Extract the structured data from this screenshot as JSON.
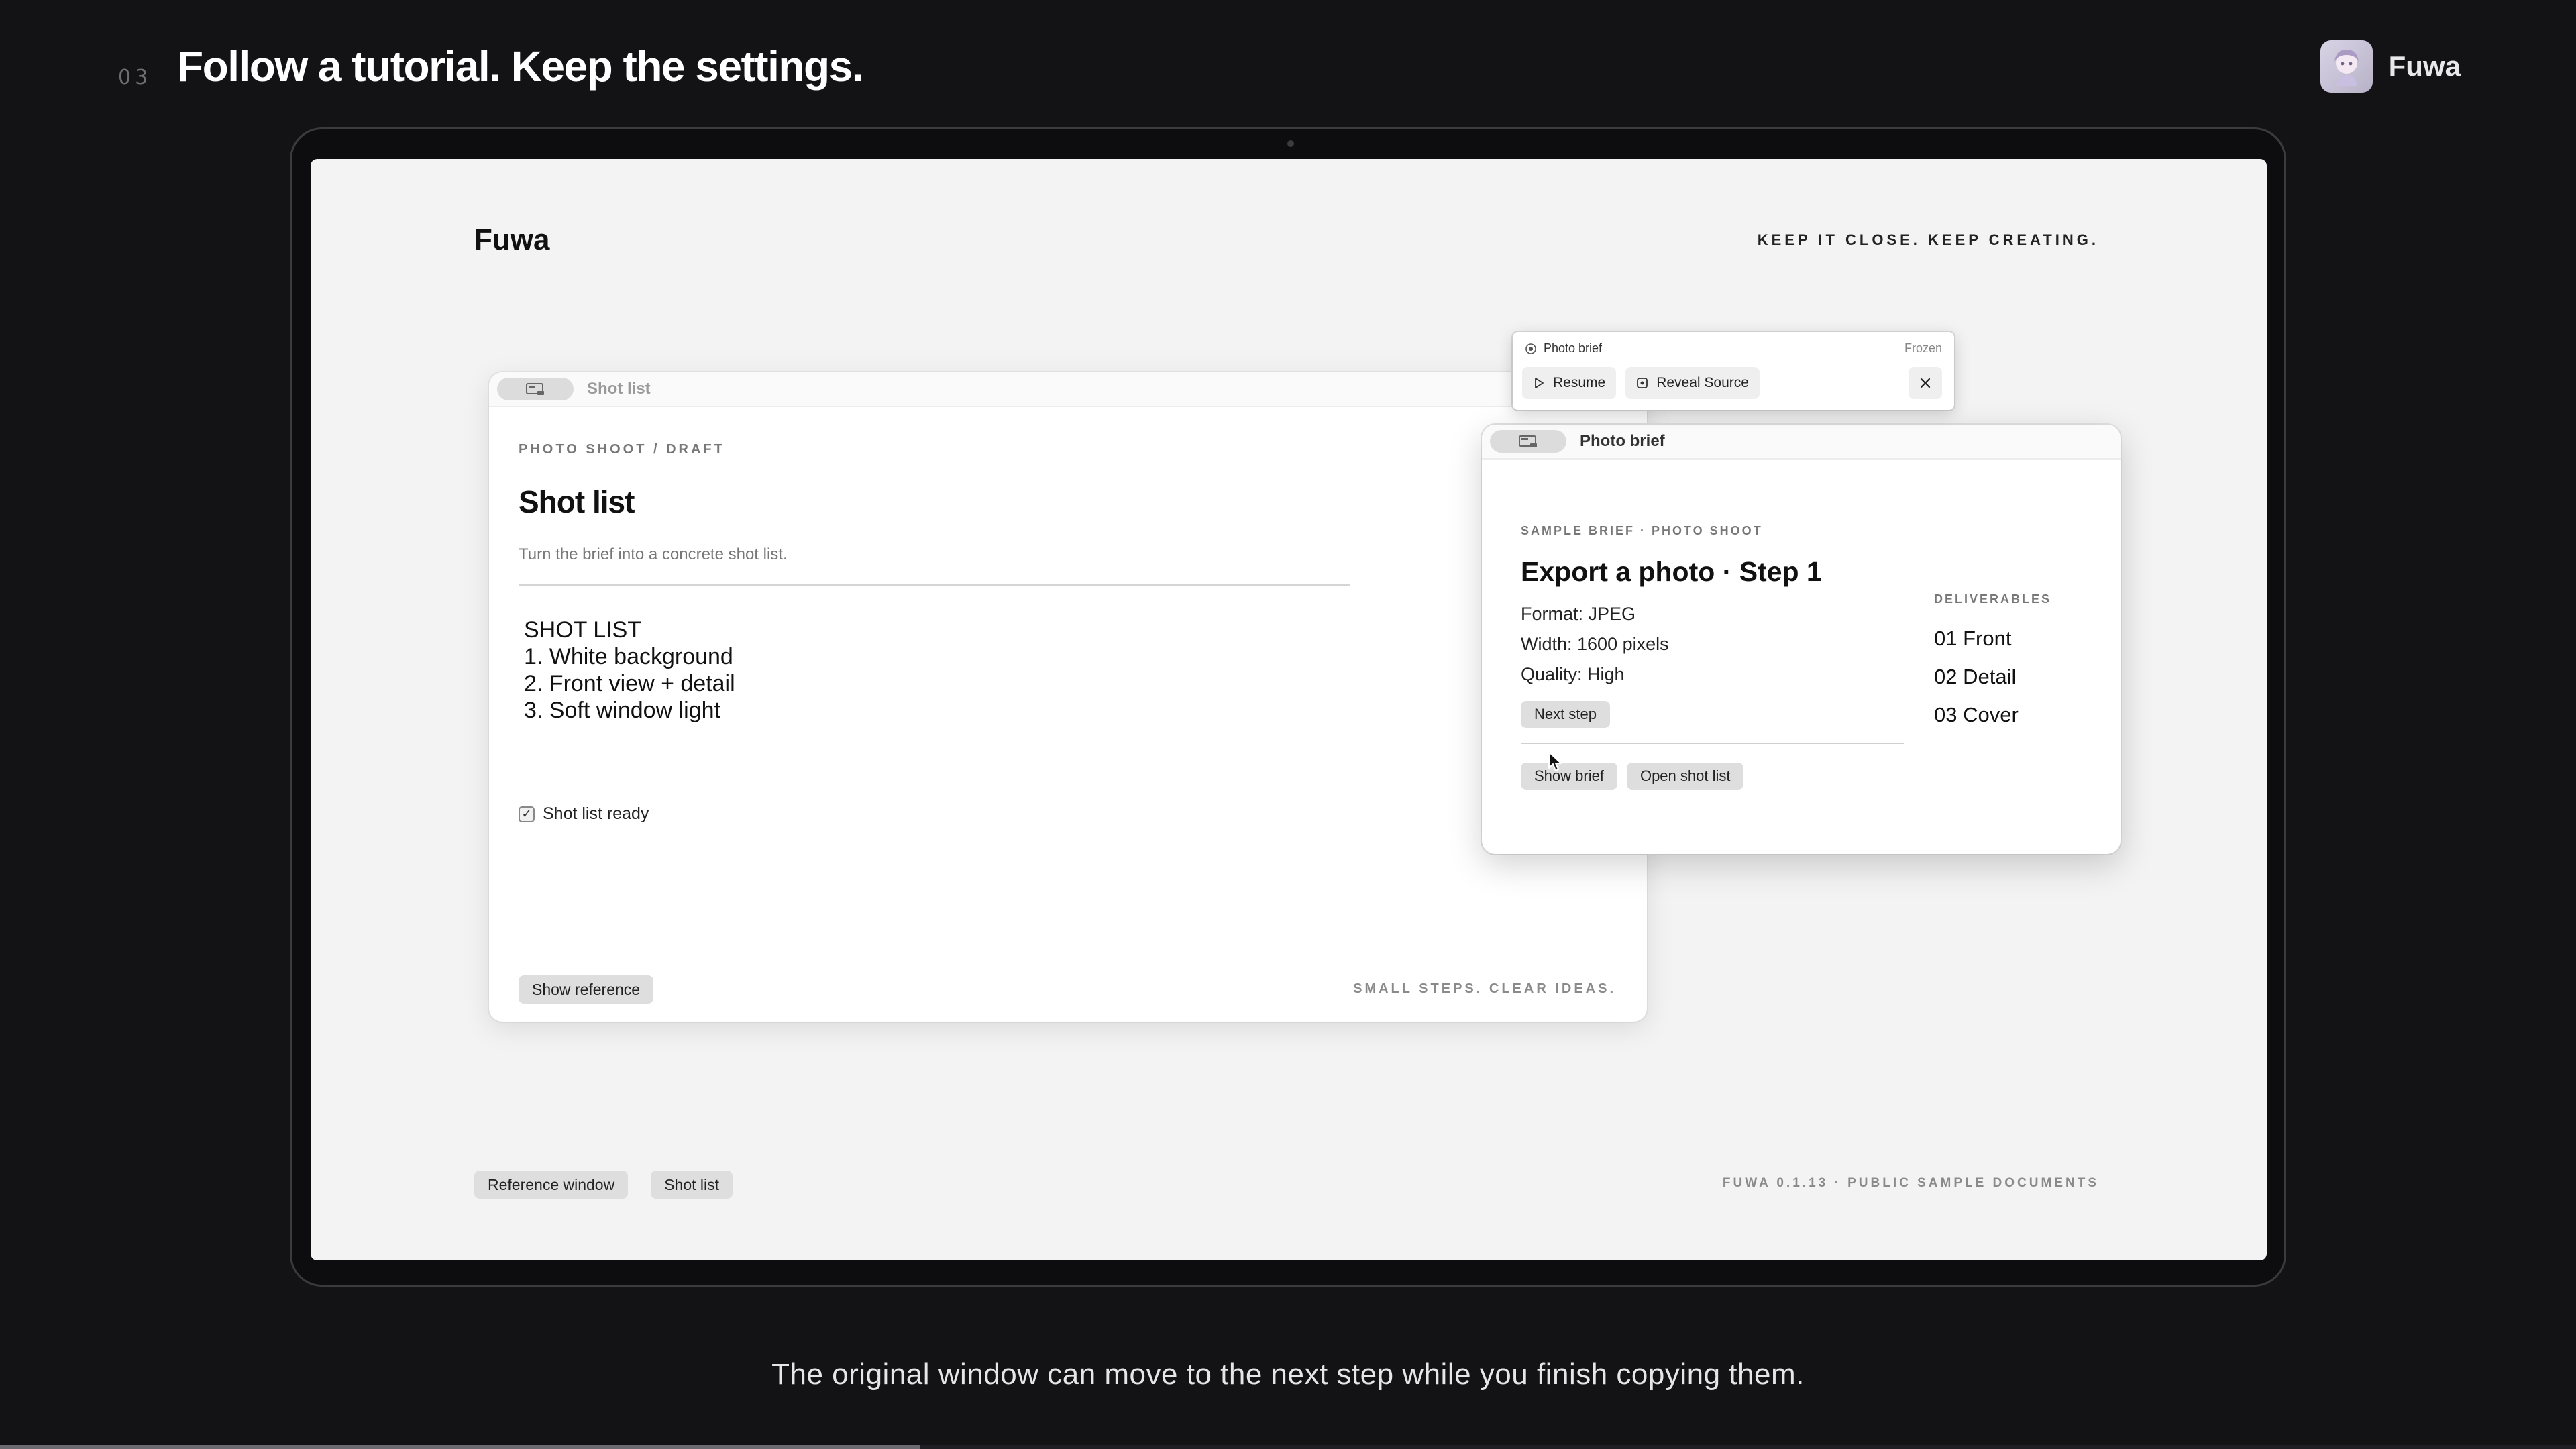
{
  "slide": {
    "step_number": "03",
    "headline": "Follow a tutorial. Keep the settings.",
    "caption": "The original window can move to the next step while you finish copying them.",
    "progress_fraction": 0.357
  },
  "brand": {
    "name": "Fuwa"
  },
  "screen": {
    "app_logo": "Fuwa",
    "tagline": "KEEP IT CLOSE. KEEP CREATING.",
    "version": "FUWA 0.1.13 · PUBLIC SAMPLE DOCUMENTS",
    "bottom_buttons": [
      "Reference window",
      "Shot list"
    ]
  },
  "shot_window": {
    "title": "Shot list",
    "kicker": "PHOTO SHOOT / DRAFT",
    "heading": "Shot list",
    "subtitle": "Turn the brief into a concrete shot list.",
    "body_lines": [
      "SHOT LIST",
      "1. White background",
      "2. Front view + detail",
      "3. Soft window light"
    ],
    "checkbox_label": "Shot list ready",
    "checkbox_checked": true,
    "show_reference_label": "Show reference",
    "footer_note": "SMALL STEPS. CLEAR IDEAS."
  },
  "brief_window": {
    "title": "Photo brief",
    "kicker": "SAMPLE BRIEF · PHOTO SHOOT",
    "heading": "Export a photo · Step 1",
    "specs": [
      "Format: JPEG",
      "Width: 1600 pixels",
      "Quality: High"
    ],
    "next_step_label": "Next step",
    "actions": [
      "Show brief",
      "Open shot list"
    ],
    "deliverables_label": "DELIVERABLES",
    "deliverables": [
      "01 Front",
      "02 Detail",
      "03 Cover"
    ]
  },
  "float_panel": {
    "title": "Photo brief",
    "status": "Frozen",
    "resume_label": "Resume",
    "reveal_label": "Reveal Source"
  },
  "icons": {
    "window_badge": "window-icon",
    "resume": "play-icon",
    "reveal": "reveal-source-icon",
    "close": "close-icon",
    "target": "target-icon"
  }
}
